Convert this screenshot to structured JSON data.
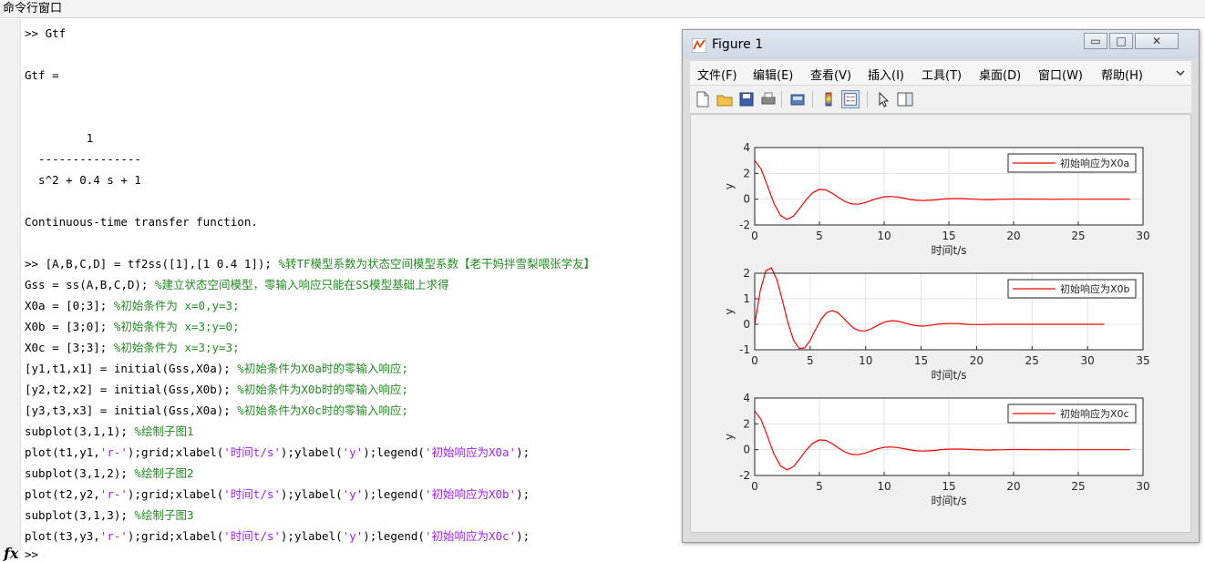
{
  "window": {
    "title": "命令行窗口"
  },
  "command_lines": [
    [
      {
        "t": ">> Gtf"
      }
    ],
    [],
    [
      {
        "t": "Gtf ="
      }
    ],
    [],
    [],
    [
      {
        "t": "         1"
      }
    ],
    [
      {
        "t": "  ---------------"
      }
    ],
    [
      {
        "t": "  s^2 + 0.4 s + 1"
      }
    ],
    [],
    [
      {
        "t": "Continuous-time transfer function."
      }
    ],
    [],
    [
      {
        "t": ">> [A,B,C,D] = tf2ss([1],[1 0.4 1]); "
      },
      {
        "t": "%转TF模型系数为状态空间模型系数【老干妈拌雪梨喂张学友】",
        "c": "cmt"
      }
    ],
    [
      {
        "t": "Gss = ss(A,B,C,D); "
      },
      {
        "t": "%建立状态空间模型，零输入响应只能在SS模型基础上求得",
        "c": "cmt"
      }
    ],
    [
      {
        "t": "X0a = [0;3]; "
      },
      {
        "t": "%初始条件为 x=0,y=3;",
        "c": "cmt"
      }
    ],
    [
      {
        "t": "X0b = [3;0]; "
      },
      {
        "t": "%初始条件为 x=3;y=0;",
        "c": "cmt"
      }
    ],
    [
      {
        "t": "X0c = [3;3]; "
      },
      {
        "t": "%初始条件为 x=3;y=3;",
        "c": "cmt"
      }
    ],
    [
      {
        "t": "[y1,t1,x1] = initial(Gss,X0a); "
      },
      {
        "t": "%初始条件为X0a时的零输入响应;",
        "c": "cmt"
      }
    ],
    [
      {
        "t": "[y2,t2,x2] = initial(Gss,X0b); "
      },
      {
        "t": "%初始条件为X0b时的零输入响应;",
        "c": "cmt"
      }
    ],
    [
      {
        "t": "[y3,t3,x3] = initial(Gss,X0a); "
      },
      {
        "t": "%初始条件为X0c时的零输入响应;",
        "c": "cmt"
      }
    ],
    [
      {
        "t": "subplot(3,1,1); "
      },
      {
        "t": "%绘制子图1",
        "c": "cmt"
      }
    ],
    [
      {
        "t": "plot(t1,y1,"
      },
      {
        "t": "'r-'",
        "c": "str"
      },
      {
        "t": ");grid;xlabel("
      },
      {
        "t": "'时间t/s'",
        "c": "str"
      },
      {
        "t": ");ylabel("
      },
      {
        "t": "'y'",
        "c": "str"
      },
      {
        "t": ");legend("
      },
      {
        "t": "'初始响应为X0a'",
        "c": "str"
      },
      {
        "t": ");"
      }
    ],
    [
      {
        "t": "subplot(3,1,2); "
      },
      {
        "t": "%绘制子图2",
        "c": "cmt"
      }
    ],
    [
      {
        "t": "plot(t2,y2,"
      },
      {
        "t": "'r-'",
        "c": "str"
      },
      {
        "t": ");grid;xlabel("
      },
      {
        "t": "'时间t/s'",
        "c": "str"
      },
      {
        "t": ");ylabel("
      },
      {
        "t": "'y'",
        "c": "str"
      },
      {
        "t": ");legend("
      },
      {
        "t": "'初始响应为X0b'",
        "c": "str"
      },
      {
        "t": ");"
      }
    ],
    [
      {
        "t": "subplot(3,1,3); "
      },
      {
        "t": "%绘制子图3",
        "c": "cmt"
      }
    ],
    [
      {
        "t": "plot(t3,y3,"
      },
      {
        "t": "'r-'",
        "c": "str"
      },
      {
        "t": ");grid;xlabel("
      },
      {
        "t": "'时间t/s'",
        "c": "str"
      },
      {
        "t": ");ylabel("
      },
      {
        "t": "'y'",
        "c": "str"
      },
      {
        "t": ");legend("
      },
      {
        "t": "'初始响应为X0c'",
        "c": "str"
      },
      {
        "t": ");"
      }
    ]
  ],
  "prompt": ">>",
  "fx_label": "fx",
  "colors": {
    "comment": "#228b22",
    "string": "#a020f0",
    "line": "#ff0000"
  },
  "figure": {
    "title": "Figure 1",
    "window_buttons": [
      "▭",
      "□",
      "✕"
    ],
    "menu": [
      "文件(F)",
      "编辑(E)",
      "查看(V)",
      "插入(I)",
      "工具(T)",
      "桌面(D)",
      "窗口(W)",
      "帮助(H)"
    ],
    "toolbar_icons": [
      "new-file-icon",
      "open-folder-icon",
      "save-icon",
      "print-icon",
      "print-preview-icon",
      "colorbar-icon",
      "legend-icon",
      "pointer-icon",
      "property-editor-icon"
    ]
  },
  "chart_data": [
    {
      "type": "line",
      "x": [
        0,
        0.5,
        1,
        1.5,
        2,
        2.5,
        3,
        3.5,
        4,
        4.5,
        5,
        5.5,
        6,
        6.5,
        7,
        7.5,
        8,
        8.5,
        9,
        9.5,
        10,
        10.5,
        11,
        11.5,
        12,
        12.5,
        13,
        13.5,
        14,
        14.5,
        15,
        15.5,
        16,
        16.5,
        17,
        17.5,
        18,
        18.5,
        19,
        19.5,
        20,
        20.5,
        21,
        21.5,
        22,
        22.5,
        23,
        23.5,
        24,
        24.5,
        25,
        25.5,
        26,
        26.5,
        27,
        27.5,
        28,
        28.5,
        29
      ],
      "y": [
        3,
        2.32,
        0.99,
        -0.36,
        -1.27,
        -1.57,
        -1.3,
        -0.68,
        -0.01,
        0.51,
        0.76,
        0.72,
        0.45,
        0.11,
        -0.2,
        -0.37,
        -0.39,
        -0.28,
        -0.1,
        0.07,
        0.18,
        0.21,
        0.17,
        0.08,
        -0.02,
        -0.09,
        -0.11,
        -0.09,
        -0.05,
        0.01,
        0.04,
        0.05,
        0.05,
        0.02,
        0,
        -0.02,
        -0.03,
        -0.02,
        -0.01,
        0,
        0.01,
        0.01,
        0.01,
        0,
        0,
        0,
        -0.01,
        0,
        0,
        0,
        0,
        0,
        0,
        0,
        0,
        0,
        0,
        0,
        0
      ],
      "xlim": [
        0,
        30
      ],
      "ylim": [
        -2,
        4
      ],
      "xticks": [
        0,
        5,
        10,
        15,
        20,
        25,
        30
      ],
      "yticks": [
        -2,
        0,
        2,
        4
      ],
      "xlabel": "时间t/s",
      "ylabel": "y",
      "legend": "初始响应为X0a",
      "legend_position": "top-right",
      "grid": true
    },
    {
      "type": "line",
      "x": [
        0,
        0.5,
        1,
        1.5,
        2,
        2.5,
        3,
        3.5,
        4,
        4.5,
        5,
        5.5,
        6,
        6.5,
        7,
        7.5,
        8,
        8.5,
        9,
        9.5,
        10,
        10.5,
        11,
        11.5,
        12,
        12.5,
        13,
        13.5,
        14,
        14.5,
        15,
        15.5,
        16,
        16.5,
        17,
        17.5,
        18,
        18.5,
        19,
        19.5,
        20,
        20.5,
        21,
        21.5,
        22,
        22.5,
        23,
        23.5,
        24,
        24.5,
        25,
        25.5,
        26,
        26.5,
        27,
        27.5,
        28,
        28.5,
        29,
        29.5,
        30,
        30.5,
        31,
        31.5
      ],
      "y": [
        0,
        1.32,
        2.1,
        2.21,
        1.75,
        0.93,
        0.05,
        -0.62,
        -0.95,
        -0.93,
        -0.63,
        -0.2,
        0.2,
        0.46,
        0.54,
        0.45,
        0.24,
        0.01,
        -0.17,
        -0.26,
        -0.26,
        -0.18,
        -0.06,
        0.05,
        0.12,
        0.14,
        0.11,
        0.05,
        -0.01,
        -0.05,
        -0.07,
        -0.06,
        -0.03,
        0,
        0.02,
        0.03,
        0.03,
        0.02,
        0,
        -0.01,
        -0.01,
        -0.01,
        -0.01,
        0,
        0,
        0,
        0,
        0,
        0,
        0,
        0,
        0,
        0,
        0,
        0,
        0,
        0,
        0,
        0,
        0,
        0,
        0,
        0,
        0
      ],
      "xlim": [
        0,
        35
      ],
      "ylim": [
        -1,
        2
      ],
      "xticks": [
        0,
        5,
        10,
        15,
        20,
        25,
        30,
        35
      ],
      "yticks": [
        -1,
        0,
        1,
        2
      ],
      "xlabel": "时间t/s",
      "ylabel": "y",
      "legend": "初始响应为X0b",
      "legend_position": "top-right",
      "grid": true
    },
    {
      "type": "line",
      "x": [
        0,
        0.5,
        1,
        1.5,
        2,
        2.5,
        3,
        3.5,
        4,
        4.5,
        5,
        5.5,
        6,
        6.5,
        7,
        7.5,
        8,
        8.5,
        9,
        9.5,
        10,
        10.5,
        11,
        11.5,
        12,
        12.5,
        13,
        13.5,
        14,
        14.5,
        15,
        15.5,
        16,
        16.5,
        17,
        17.5,
        18,
        18.5,
        19,
        19.5,
        20,
        20.5,
        21,
        21.5,
        22,
        22.5,
        23,
        23.5,
        24,
        24.5,
        25,
        25.5,
        26,
        26.5,
        27,
        27.5,
        28,
        28.5,
        29
      ],
      "y": [
        3,
        2.32,
        0.99,
        -0.36,
        -1.27,
        -1.57,
        -1.3,
        -0.68,
        -0.01,
        0.51,
        0.76,
        0.72,
        0.45,
        0.11,
        -0.2,
        -0.37,
        -0.39,
        -0.28,
        -0.1,
        0.07,
        0.18,
        0.21,
        0.17,
        0.08,
        -0.02,
        -0.09,
        -0.11,
        -0.09,
        -0.05,
        0.01,
        0.04,
        0.05,
        0.05,
        0.02,
        0,
        -0.02,
        -0.03,
        -0.02,
        -0.01,
        0,
        0.01,
        0.01,
        0.01,
        0,
        0,
        0,
        -0.01,
        0,
        0,
        0,
        0,
        0,
        0,
        0,
        0,
        0,
        0,
        0,
        0
      ],
      "xlim": [
        0,
        30
      ],
      "ylim": [
        -2,
        4
      ],
      "xticks": [
        0,
        5,
        10,
        15,
        20,
        25,
        30
      ],
      "yticks": [
        -2,
        0,
        2,
        4
      ],
      "xlabel": "时间t/s",
      "ylabel": "y",
      "legend": "初始响应为X0c",
      "legend_position": "top-right",
      "grid": true
    }
  ]
}
